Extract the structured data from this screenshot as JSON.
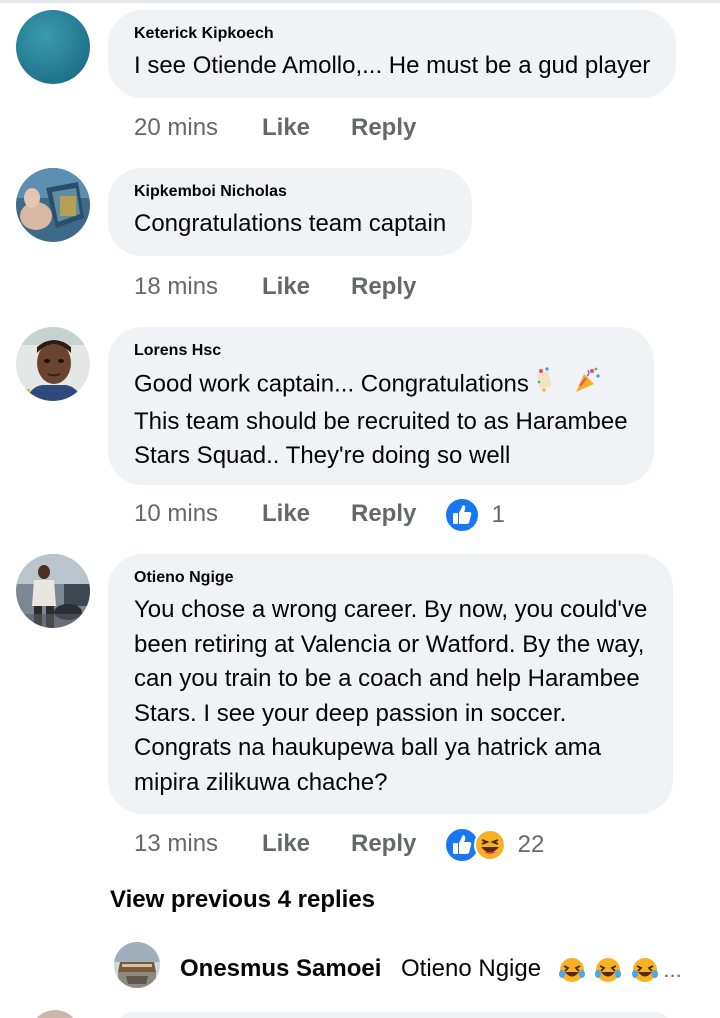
{
  "comments": [
    {
      "author": "Keterick Kipkoech",
      "text": "I see Otiende Amollo,... He must be a gud player",
      "time": "20 mins",
      "like": "Like",
      "reply": "Reply"
    },
    {
      "author": "Kipkemboi Nicholas",
      "text": "Congratulations team captain",
      "time": "18 mins",
      "like": "Like",
      "reply": "Reply"
    },
    {
      "author": "Lorens Hsc",
      "text_line1": "Good work captain... Congratulations",
      "text_line2": "This team should be recruited to as Harambee",
      "text_line3": "Stars Squad.. They're doing so well",
      "time": "10 mins",
      "like": "Like",
      "reply": "Reply",
      "reaction_count": "1"
    },
    {
      "author": "Otieno Ngige",
      "text_line1": "You chose a wrong career. By now, you could've",
      "text_line2": "been retiring at Valencia or Watford. By the way,",
      "text_line3": "can you train to be a coach and help Harambee",
      "text_line4": "Stars. I see your deep passion in soccer.",
      "text_line5": "Congrats na haukupewa ball ya hatrick ama",
      "text_line6": "mipira zilikuwa chache?",
      "time": "13 mins",
      "like": "Like",
      "reply": "Reply",
      "reaction_count": "22"
    }
  ],
  "view_previous": "View previous 4 replies",
  "latest_reply": {
    "author": "Onesmus Samoei",
    "text": "Otieno Ngige",
    "ellipsis": "..."
  },
  "icons": {
    "like_reaction": "like-reaction-icon",
    "haha_reaction": "haha-reaction-icon",
    "party_emoji": "party-popper-emoji",
    "laughing_emoji": "rofl-emoji"
  },
  "colors": {
    "bubble": "#f0f2f5",
    "meta_text": "#65676b",
    "like_blue": "#1877f2",
    "haha_yellow": "#f7b125"
  }
}
